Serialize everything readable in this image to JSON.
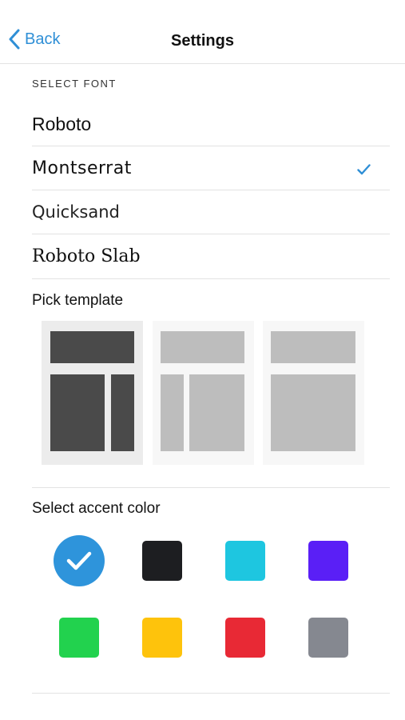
{
  "nav": {
    "back_label": "Back",
    "title": "Settings"
  },
  "font_section": {
    "header": "SELECT FONT",
    "fonts": [
      {
        "label": "Roboto",
        "selected": false
      },
      {
        "label": "Montserrat",
        "selected": true
      },
      {
        "label": "Quicksand",
        "selected": false
      },
      {
        "label": "Roboto Slab",
        "selected": false
      }
    ]
  },
  "template_section": {
    "label": "Pick template",
    "templates": [
      {
        "name": "header-wide-left-narrow-right",
        "selected": true
      },
      {
        "name": "header-narrow-left-wide-right",
        "selected": false
      },
      {
        "name": "header-full-body",
        "selected": false
      }
    ]
  },
  "accent_section": {
    "label": "Select accent color",
    "selected_index": 0,
    "colors": [
      "#2e94db",
      "#1d1e21",
      "#1ec6e0",
      "#5a1ff6",
      "#22d24e",
      "#fec30c",
      "#e82935",
      "#858890"
    ]
  },
  "colors": {
    "link": "#2f8fd6",
    "check": "#2f8fd6",
    "template_selected_block": "#4a4a4a",
    "template_unselected_block": "#bdbdbd"
  }
}
